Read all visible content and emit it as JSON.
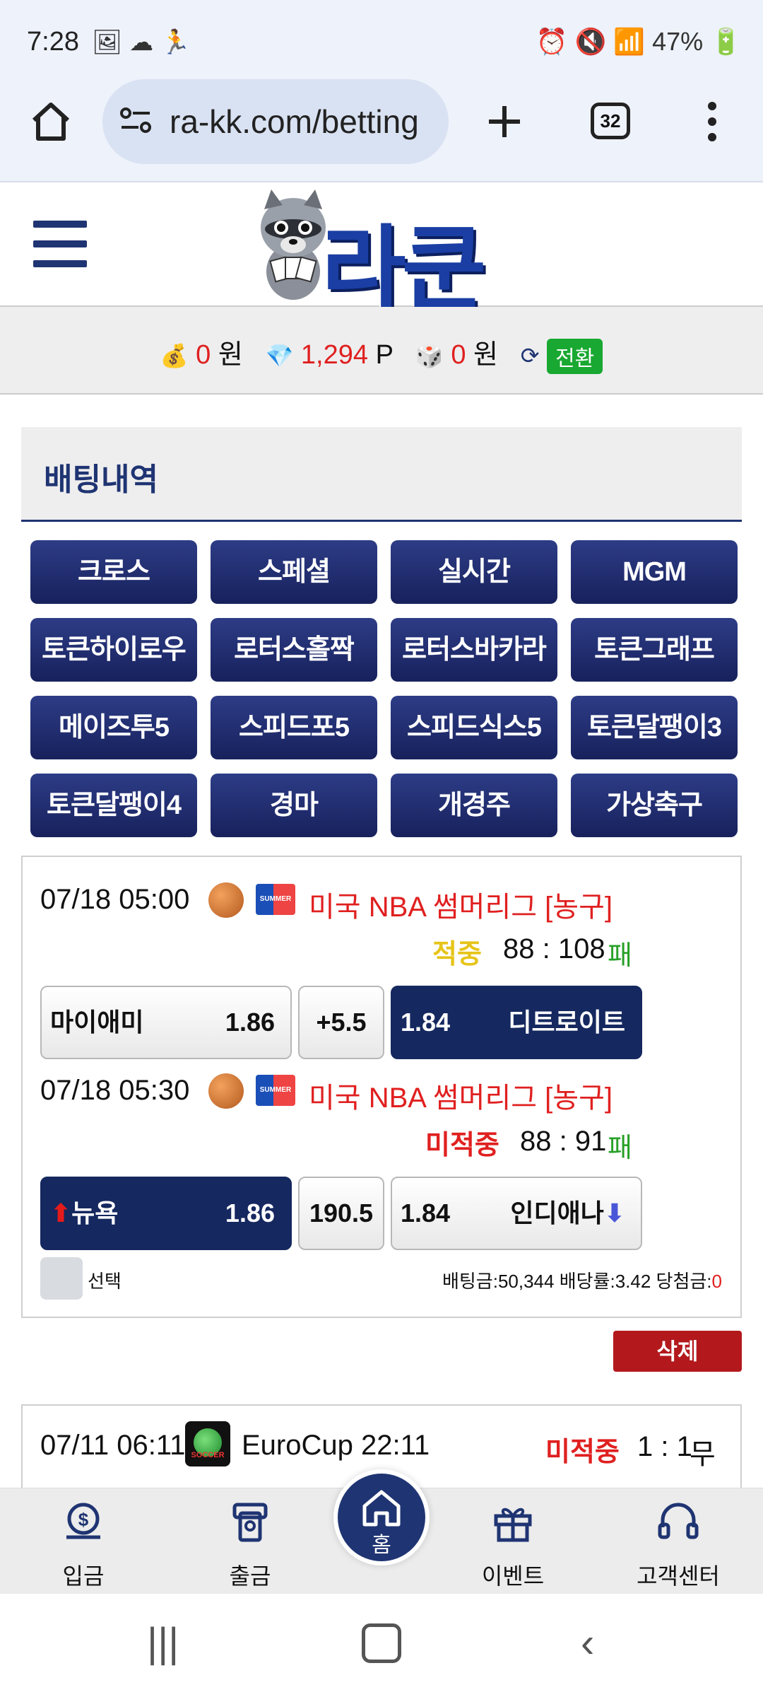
{
  "status_bar": {
    "time": "7:28",
    "battery": "47%"
  },
  "browser": {
    "url": "ra-kk.com/betting",
    "tab_count": "32"
  },
  "site": {
    "logo_text": "라쿤"
  },
  "balance": {
    "money_value": "0",
    "money_unit": "원",
    "point_value": "1,294",
    "point_unit": "P",
    "casino_value": "0",
    "casino_unit": "원",
    "switch_label": "전환"
  },
  "section": {
    "title": "배팅내역"
  },
  "categories": [
    "크로스",
    "스페셜",
    "실시간",
    "MGM",
    "토큰하이로우",
    "로터스홀짝",
    "로터스바카라",
    "토큰그래프",
    "메이즈투5",
    "스피드포5",
    "스피드식스5",
    "토큰달팽이3",
    "토큰달팽이4",
    "경마",
    "개경주",
    "가상축구"
  ],
  "bets": [
    {
      "datetime": "07/18 05:00",
      "league": "미국 NBA 썸머리그 [농구]",
      "status": "적중",
      "status_color": "#e6c419",
      "score": "88 : 108",
      "result": "패",
      "home": "마이애미",
      "home_odds": "1.86",
      "line": "+5.5",
      "away_odds": "1.84",
      "away": "디트로이트"
    },
    {
      "datetime": "07/18 05:30",
      "league": "미국 NBA 썸머리그 [농구]",
      "status": "미적중",
      "status_color": "#e02020",
      "score": "88 : 91",
      "result": "패",
      "home": "뉴욕",
      "home_odds": "1.86",
      "line": "190.5",
      "away_odds": "1.84",
      "away": "인디애나"
    }
  ],
  "slip": {
    "select_label": "선택",
    "bet_amount_label": "배팅금:",
    "bet_amount": "50,344",
    "odds_label": "배당률:",
    "odds": "3.42",
    "win_label": "당첨금:",
    "win": "0",
    "delete_label": "삭제"
  },
  "bet3": {
    "datetime": "07/11 06:11",
    "league": "EuroCup 22:11",
    "status": "미적중",
    "score": "1 : 1",
    "result": "무"
  },
  "bottom_nav": {
    "deposit": "입금",
    "withdraw": "출금",
    "home": "홈",
    "event": "이벤트",
    "support": "고객센터"
  },
  "colors": {
    "primary": "#1f3472",
    "red": "#e02020",
    "green": "#19a831",
    "delete": "#b3191c"
  }
}
